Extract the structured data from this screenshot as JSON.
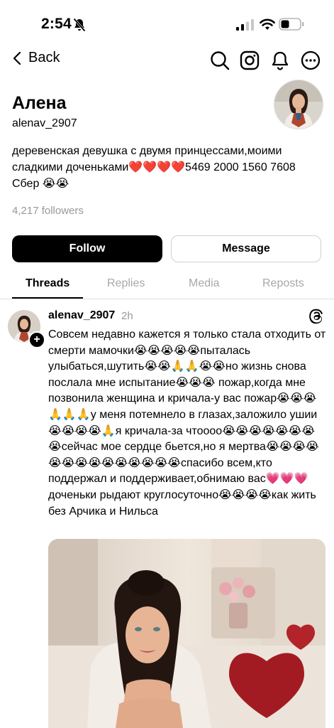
{
  "status": {
    "time": "2:54"
  },
  "nav": {
    "back_label": "Back"
  },
  "profile": {
    "name": "Алена",
    "handle": "alenav_2907",
    "bio": "деревенская девушка с двумя принцессами,моими сладкими доченьками❤️❤️❤️❤️5469 2000 1560 7608 Сбер 😭😭",
    "followers": "4,217 followers"
  },
  "actions": {
    "follow_label": "Follow",
    "message_label": "Message"
  },
  "tabs": [
    {
      "label": "Threads"
    },
    {
      "label": "Replies"
    },
    {
      "label": "Media"
    },
    {
      "label": "Reposts"
    }
  ],
  "post": {
    "username": "alenav_2907",
    "time": "2h",
    "text": "Совсем недавно кажется я только стала отходить от смерти мамочки😭😭😭😭😭пыталась улыбаться,шутить😭😭🙏🙏😭😭но жизнь снова послала мне испытание😭😭😭 пожар,когда мне позвонила женщина и кричала-у вас пожар😭😭😭🙏🙏🙏у меня потемнело в глазах,заложило ушии😭😭😭😭🙏я кричала-за чтоооо😭😭😭😭😭😭😭😭сейчас мое сердце бьется,но я мертва😭😭😭😭😭😭😭😭😭😭😭😭😭😭спасибо всем,кто поддержал и поддерживает,обнимаю вас💗💗💗доченьки рыдают круглосуточно😭😭😭😭как жить без Арчика и Нильса"
  },
  "icons": [
    "bell-off-icon",
    "signal-icon",
    "wifi-icon",
    "battery-icon",
    "chevron-left-icon",
    "search-icon",
    "instagram-icon",
    "notification-bell-icon",
    "more-icon",
    "plus-icon",
    "threads-logo-icon"
  ],
  "colors": {
    "follow_bg": "#000000",
    "muted": "#999999",
    "tab_inactive": "#a8a8a8"
  }
}
